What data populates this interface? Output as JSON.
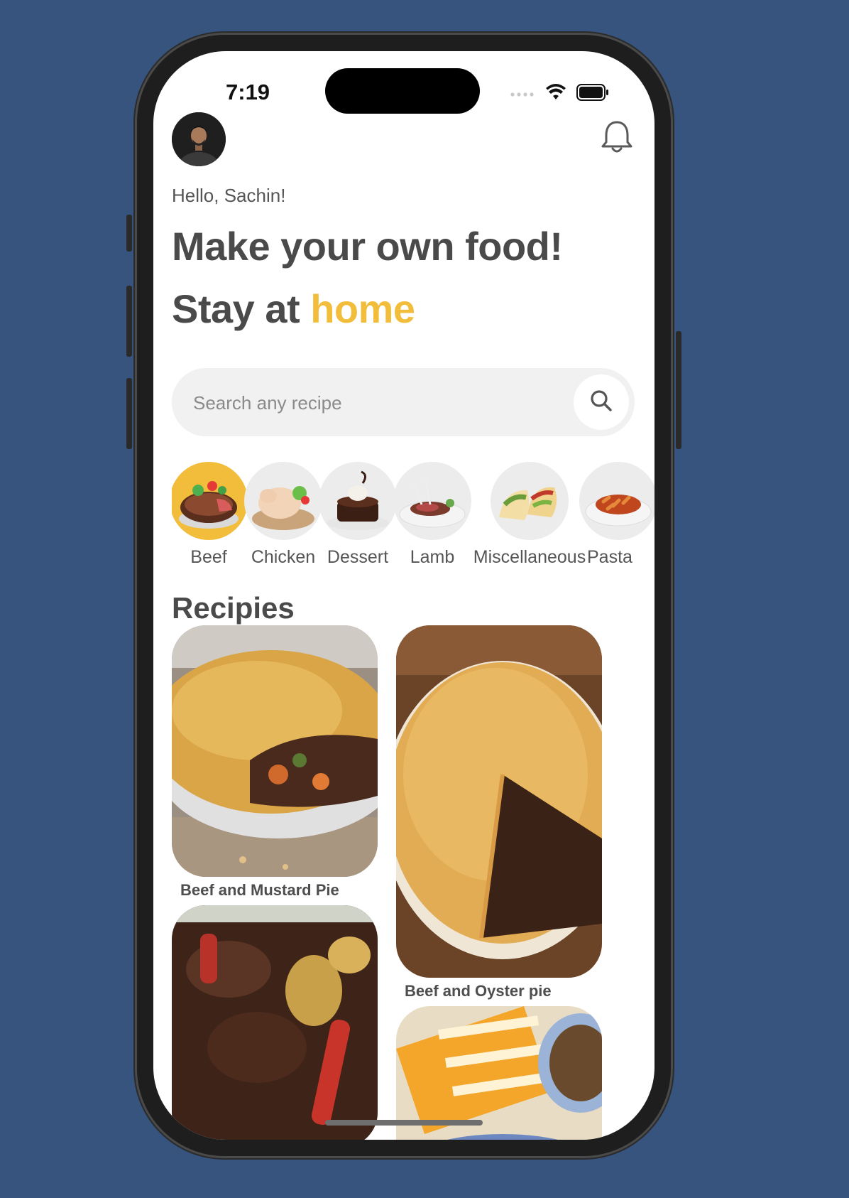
{
  "status_bar": {
    "time": "7:19"
  },
  "header": {
    "greeting": "Hello, Sachin!"
  },
  "headline": {
    "line1": "Make your own food!",
    "line2_prefix": "Stay at ",
    "line2_accent": "home"
  },
  "search": {
    "placeholder": "Search any recipe",
    "value": ""
  },
  "categories": [
    {
      "label": "Beef",
      "active": true
    },
    {
      "label": "Chicken"
    },
    {
      "label": "Dessert"
    },
    {
      "label": "Lamb"
    },
    {
      "label": "Miscellaneous"
    },
    {
      "label": "Pasta"
    }
  ],
  "recipes_section": {
    "title": "Recipies"
  },
  "recipes": [
    {
      "title": "Beef and Mustard Pie"
    },
    {
      "title": "Beef and Oyster pie"
    },
    {
      "title": ""
    },
    {
      "title": ""
    }
  ],
  "colors": {
    "accent": "#f3bd3c",
    "background": "#37547f",
    "text": "#4a4a4a",
    "search_bg": "#f1f1f1"
  }
}
